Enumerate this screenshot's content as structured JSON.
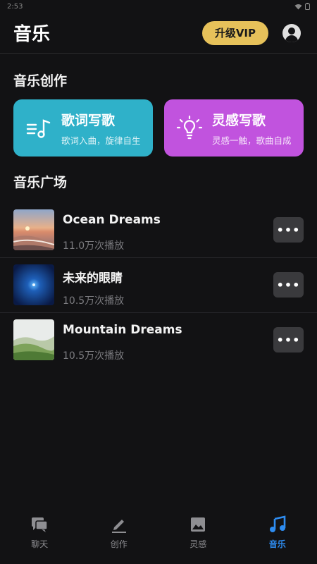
{
  "status_bar": {
    "time": "2:53"
  },
  "header": {
    "title": "音乐",
    "vip_label": "升级VIP"
  },
  "create_section": {
    "title": "音乐创作",
    "cards": [
      {
        "name": "歌词写歌",
        "desc": "歌词入曲，旋律自生",
        "icon": "music-lyrics-icon",
        "color": "#2fb1c9"
      },
      {
        "name": "灵感写歌",
        "desc": "灵感一触，歌曲自成",
        "icon": "lightbulb-icon",
        "color": "#c153de"
      }
    ]
  },
  "plaza": {
    "title": "音乐广场",
    "songs": [
      {
        "title": "Ocean Dreams",
        "plays": "11.0万次播放",
        "more": "•••"
      },
      {
        "title": "未来的眼睛",
        "plays": "10.5万次播放",
        "more": "•••"
      },
      {
        "title": "Mountain Dreams",
        "plays": "10.5万次播放",
        "more": "•••"
      }
    ]
  },
  "tabs": [
    {
      "label": "聊天",
      "icon": "chat-icon",
      "active": false
    },
    {
      "label": "创作",
      "icon": "pencil-icon",
      "active": false
    },
    {
      "label": "灵感",
      "icon": "image-icon",
      "active": false
    },
    {
      "label": "音乐",
      "icon": "music-note-icon",
      "active": true
    }
  ],
  "colors": {
    "background": "#121214",
    "vip": "#e6c15a",
    "active_tab": "#2e8cf0"
  }
}
